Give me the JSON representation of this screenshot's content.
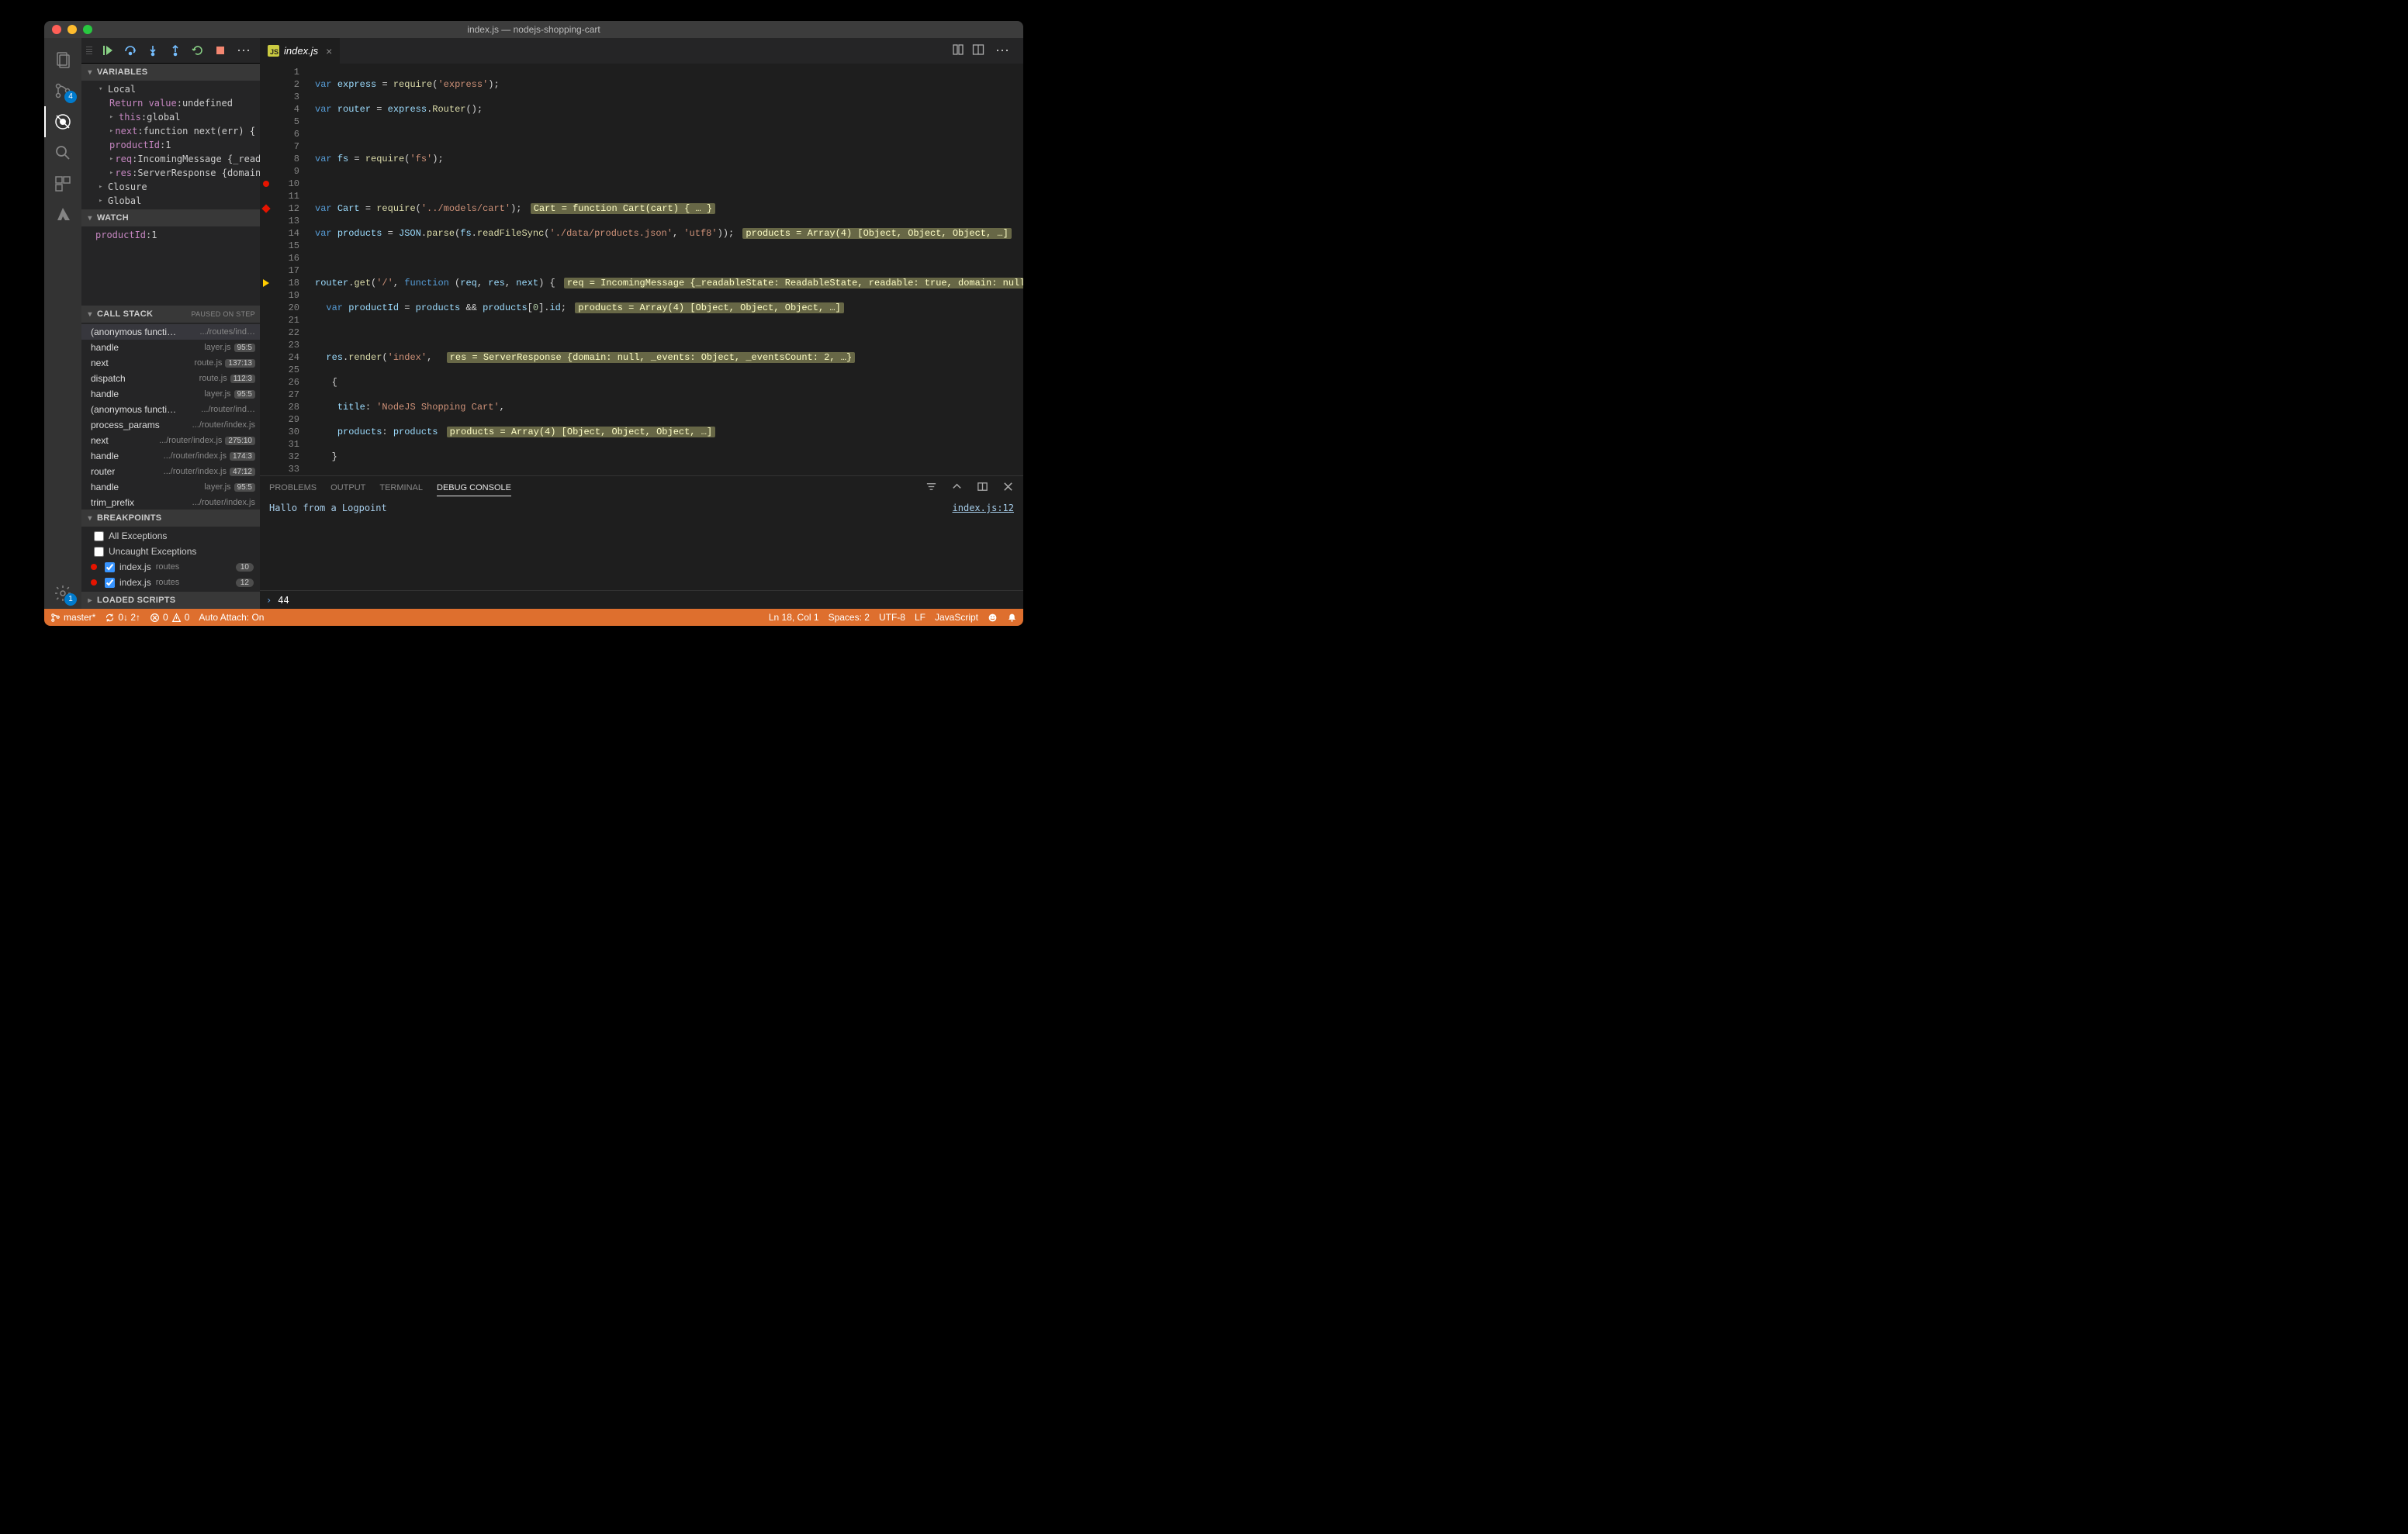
{
  "title": "index.js — nodejs-shopping-cart",
  "tab": {
    "name": "index.js"
  },
  "debug_toolbar": [
    "continue",
    "step-over",
    "step-into",
    "step-out",
    "restart",
    "stop"
  ],
  "variables": {
    "title": "VARIABLES",
    "scopes": [
      {
        "name": "Local",
        "expanded": true,
        "items": [
          {
            "k": "Return value",
            "v": "undefined",
            "leaf": true
          },
          {
            "k": "this",
            "v": "global",
            "leaf": false
          },
          {
            "k": "next",
            "v": "function next(err) { … }",
            "leaf": false
          },
          {
            "k": "productId",
            "v": "1",
            "leaf": true
          },
          {
            "k": "req",
            "v": "IncomingMessage {_readableSt…",
            "leaf": false
          },
          {
            "k": "res",
            "v": "ServerResponse {domain: null…",
            "leaf": false
          }
        ]
      },
      {
        "name": "Closure",
        "expanded": false
      },
      {
        "name": "Global",
        "expanded": false
      }
    ]
  },
  "watch": {
    "title": "WATCH",
    "items": [
      {
        "k": "productId",
        "v": "1"
      }
    ]
  },
  "callstack": {
    "title": "CALL STACK",
    "note": "PAUSED ON STEP",
    "frames": [
      {
        "fn": "(anonymous function)",
        "file": ".../routes/ind…",
        "loc": "",
        "sel": true
      },
      {
        "fn": "handle",
        "file": "layer.js",
        "loc": "95:5"
      },
      {
        "fn": "next",
        "file": "route.js",
        "loc": "137:13"
      },
      {
        "fn": "dispatch",
        "file": "route.js",
        "loc": "112:3"
      },
      {
        "fn": "handle",
        "file": "layer.js",
        "loc": "95:5"
      },
      {
        "fn": "(anonymous function)",
        "file": ".../router/ind…",
        "loc": ""
      },
      {
        "fn": "process_params",
        "file": ".../router/index.js",
        "loc": ""
      },
      {
        "fn": "next",
        "file": ".../router/index.js",
        "loc": "275:10"
      },
      {
        "fn": "handle",
        "file": ".../router/index.js",
        "loc": "174:3"
      },
      {
        "fn": "router",
        "file": ".../router/index.js",
        "loc": "47:12"
      },
      {
        "fn": "handle",
        "file": "layer.js",
        "loc": "95:5"
      },
      {
        "fn": "trim_prefix",
        "file": ".../router/index.js",
        "loc": ""
      }
    ]
  },
  "breakpoints": {
    "title": "BREAKPOINTS",
    "builtin": [
      {
        "label": "All Exceptions",
        "checked": false
      },
      {
        "label": "Uncaught Exceptions",
        "checked": false
      }
    ],
    "items": [
      {
        "label": "index.js",
        "folder": "routes",
        "count": "10"
      },
      {
        "label": "index.js",
        "folder": "routes",
        "count": "12"
      }
    ]
  },
  "loaded_scripts": {
    "title": "LOADED SCRIPTS"
  },
  "panel": {
    "tabs": [
      "PROBLEMS",
      "OUTPUT",
      "TERMINAL",
      "DEBUG CONSOLE"
    ],
    "active": 3,
    "message": "Hallo from a Logpoint",
    "link": "index.js:12",
    "input_value": "44"
  },
  "status": {
    "branch": "master*",
    "sync": "0↓ 2↑",
    "errors": "0",
    "warnings": "0",
    "auto_attach": "Auto Attach: On",
    "cursor": "Ln 18, Col 1",
    "spaces": "Spaces: 2",
    "encoding": "UTF-8",
    "eol": "LF",
    "language": "JavaScript"
  },
  "activity_badges": {
    "scm": "4",
    "settings": "1"
  },
  "code_hints": {
    "l6": "Cart = function Cart(cart) { … }",
    "l7": "products = Array(4) [Object, Object, Object, …]",
    "l9a": "req = IncomingMessage {_readableState: ReadableState, readable: true, domain: null, …}, res = ServerRes…",
    "l10": "products = Array(4) [Object, Object, Object, …]",
    "l12": "res = ServerResponse {domain: null, _events: Object, _eventsCount: 2, …}",
    "l15": "products = Array(4) [Object, Object, Object, …]"
  }
}
